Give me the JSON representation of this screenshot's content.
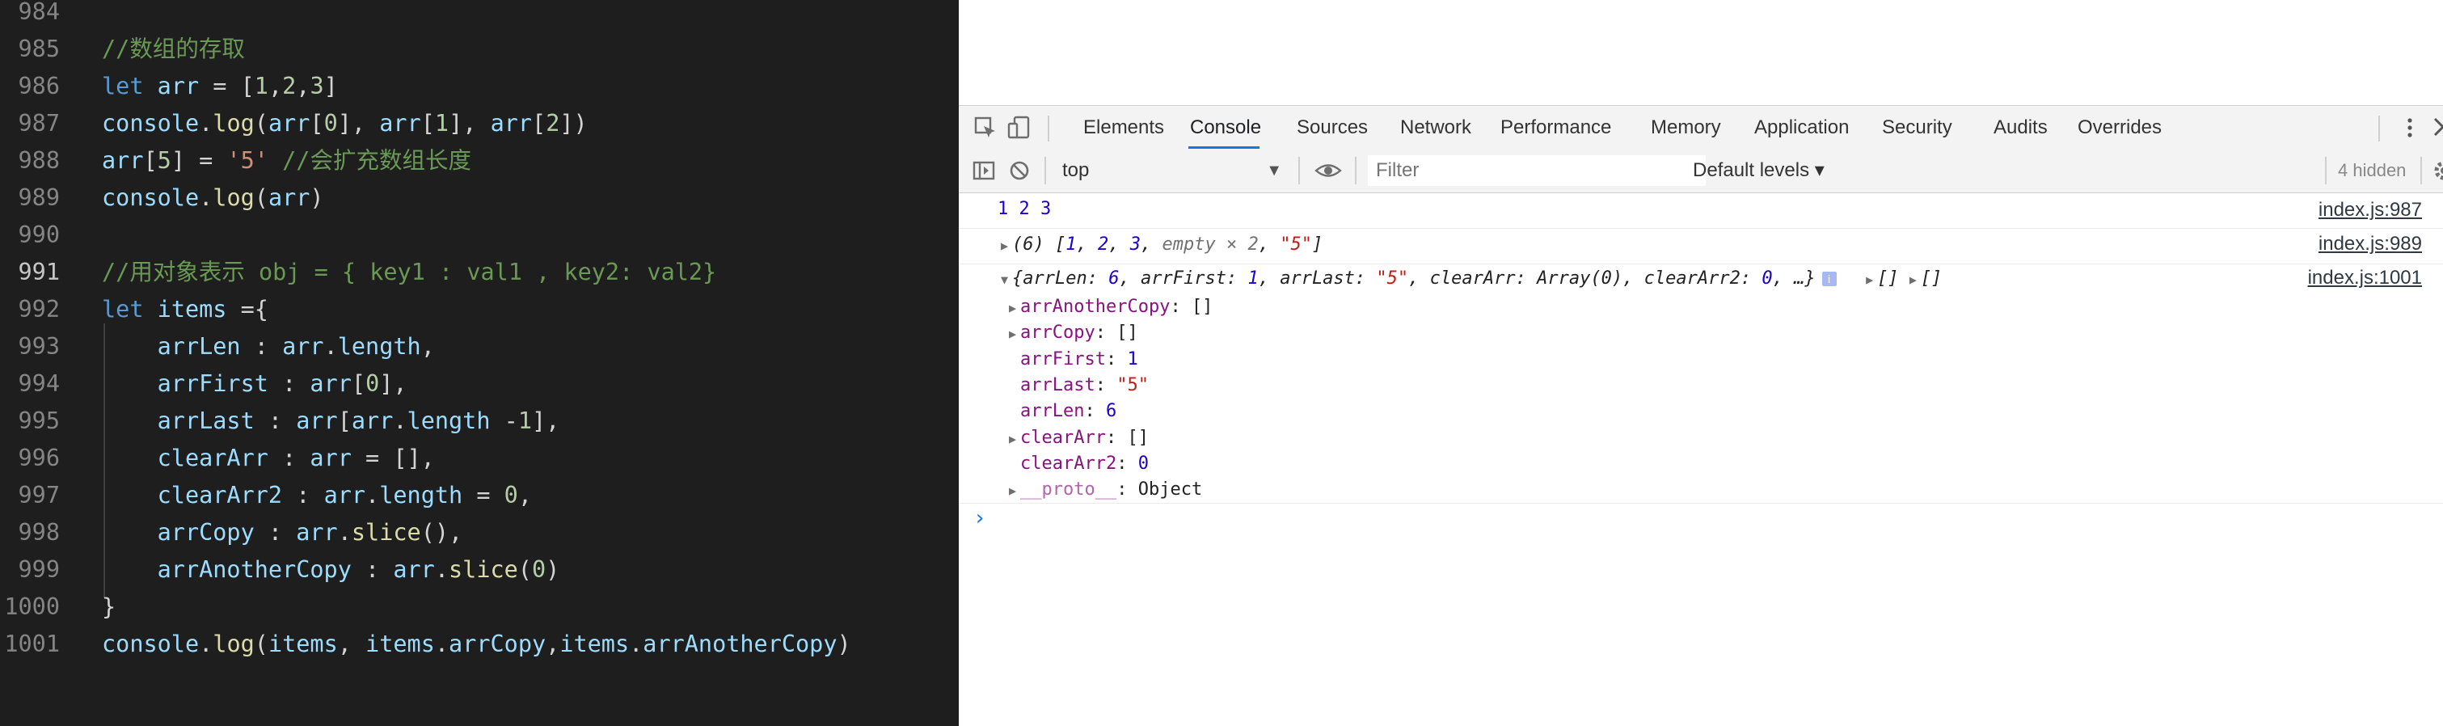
{
  "editor": {
    "lines": [
      {
        "n": "984",
        "tokens": []
      },
      {
        "n": "985",
        "tokens": [
          {
            "t": "//数组的存取",
            "c": "comment"
          }
        ]
      },
      {
        "n": "986",
        "tokens": [
          {
            "t": "let",
            "c": "keyword"
          },
          {
            "t": " ",
            "c": "plain"
          },
          {
            "t": "arr",
            "c": "var"
          },
          {
            "t": " = [",
            "c": "plain"
          },
          {
            "t": "1",
            "c": "num"
          },
          {
            "t": ",",
            "c": "plain"
          },
          {
            "t": "2",
            "c": "num"
          },
          {
            "t": ",",
            "c": "plain"
          },
          {
            "t": "3",
            "c": "num"
          },
          {
            "t": "]",
            "c": "plain"
          }
        ]
      },
      {
        "n": "987",
        "tokens": [
          {
            "t": "console",
            "c": "var"
          },
          {
            "t": ".",
            "c": "plain"
          },
          {
            "t": "log",
            "c": "func"
          },
          {
            "t": "(",
            "c": "plain"
          },
          {
            "t": "arr",
            "c": "var"
          },
          {
            "t": "[",
            "c": "plain"
          },
          {
            "t": "0",
            "c": "num"
          },
          {
            "t": "], ",
            "c": "plain"
          },
          {
            "t": "arr",
            "c": "var"
          },
          {
            "t": "[",
            "c": "plain"
          },
          {
            "t": "1",
            "c": "num"
          },
          {
            "t": "], ",
            "c": "plain"
          },
          {
            "t": "arr",
            "c": "var"
          },
          {
            "t": "[",
            "c": "plain"
          },
          {
            "t": "2",
            "c": "num"
          },
          {
            "t": "])",
            "c": "plain"
          }
        ]
      },
      {
        "n": "988",
        "tokens": [
          {
            "t": "arr",
            "c": "var"
          },
          {
            "t": "[",
            "c": "plain"
          },
          {
            "t": "5",
            "c": "num"
          },
          {
            "t": "] = ",
            "c": "plain"
          },
          {
            "t": "'5'",
            "c": "str"
          },
          {
            "t": " ",
            "c": "plain"
          },
          {
            "t": "//会扩充数组长度",
            "c": "comment"
          }
        ]
      },
      {
        "n": "989",
        "tokens": [
          {
            "t": "console",
            "c": "var"
          },
          {
            "t": ".",
            "c": "plain"
          },
          {
            "t": "log",
            "c": "func"
          },
          {
            "t": "(",
            "c": "plain"
          },
          {
            "t": "arr",
            "c": "var"
          },
          {
            "t": ")",
            "c": "plain"
          }
        ]
      },
      {
        "n": "990",
        "tokens": []
      },
      {
        "n": "991",
        "active": true,
        "tokens": [
          {
            "t": "//用对象表示 obj = { key1 : val1 , key2: val2}",
            "c": "comment"
          }
        ]
      },
      {
        "n": "992",
        "tokens": [
          {
            "t": "let",
            "c": "keyword"
          },
          {
            "t": " ",
            "c": "plain"
          },
          {
            "t": "items",
            "c": "var"
          },
          {
            "t": " ={",
            "c": "plain"
          }
        ]
      },
      {
        "n": "993",
        "tokens": [
          {
            "t": "    ",
            "c": "plain"
          },
          {
            "t": "arrLen",
            "c": "var"
          },
          {
            "t": " : ",
            "c": "plain"
          },
          {
            "t": "arr",
            "c": "var"
          },
          {
            "t": ".",
            "c": "plain"
          },
          {
            "t": "length",
            "c": "var"
          },
          {
            "t": ",",
            "c": "plain"
          }
        ]
      },
      {
        "n": "994",
        "tokens": [
          {
            "t": "    ",
            "c": "plain"
          },
          {
            "t": "arrFirst",
            "c": "var"
          },
          {
            "t": " : ",
            "c": "plain"
          },
          {
            "t": "arr",
            "c": "var"
          },
          {
            "t": "[",
            "c": "plain"
          },
          {
            "t": "0",
            "c": "num"
          },
          {
            "t": "],",
            "c": "plain"
          }
        ]
      },
      {
        "n": "995",
        "tokens": [
          {
            "t": "    ",
            "c": "plain"
          },
          {
            "t": "arrLast",
            "c": "var"
          },
          {
            "t": " : ",
            "c": "plain"
          },
          {
            "t": "arr",
            "c": "var"
          },
          {
            "t": "[",
            "c": "plain"
          },
          {
            "t": "arr",
            "c": "var"
          },
          {
            "t": ".",
            "c": "plain"
          },
          {
            "t": "length",
            "c": "var"
          },
          {
            "t": " -",
            "c": "plain"
          },
          {
            "t": "1",
            "c": "num"
          },
          {
            "t": "],",
            "c": "plain"
          }
        ]
      },
      {
        "n": "996",
        "tokens": [
          {
            "t": "    ",
            "c": "plain"
          },
          {
            "t": "clearArr",
            "c": "var"
          },
          {
            "t": " : ",
            "c": "plain"
          },
          {
            "t": "arr",
            "c": "var"
          },
          {
            "t": " = [],",
            "c": "plain"
          }
        ]
      },
      {
        "n": "997",
        "tokens": [
          {
            "t": "    ",
            "c": "plain"
          },
          {
            "t": "clearArr2",
            "c": "var"
          },
          {
            "t": " : ",
            "c": "plain"
          },
          {
            "t": "arr",
            "c": "var"
          },
          {
            "t": ".",
            "c": "plain"
          },
          {
            "t": "length",
            "c": "var"
          },
          {
            "t": " = ",
            "c": "plain"
          },
          {
            "t": "0",
            "c": "num"
          },
          {
            "t": ",",
            "c": "plain"
          }
        ]
      },
      {
        "n": "998",
        "tokens": [
          {
            "t": "    ",
            "c": "plain"
          },
          {
            "t": "arrCopy",
            "c": "var"
          },
          {
            "t": " : ",
            "c": "plain"
          },
          {
            "t": "arr",
            "c": "var"
          },
          {
            "t": ".",
            "c": "plain"
          },
          {
            "t": "slice",
            "c": "func"
          },
          {
            "t": "(),",
            "c": "plain"
          }
        ]
      },
      {
        "n": "999",
        "tokens": [
          {
            "t": "    ",
            "c": "plain"
          },
          {
            "t": "arrAnotherCopy",
            "c": "var"
          },
          {
            "t": " : ",
            "c": "plain"
          },
          {
            "t": "arr",
            "c": "var"
          },
          {
            "t": ".",
            "c": "plain"
          },
          {
            "t": "slice",
            "c": "func"
          },
          {
            "t": "(",
            "c": "plain"
          },
          {
            "t": "0",
            "c": "num"
          },
          {
            "t": ")",
            "c": "plain"
          }
        ]
      },
      {
        "n": "1000",
        "tokens": [
          {
            "t": "}",
            "c": "plain"
          }
        ]
      },
      {
        "n": "1001",
        "tokens": [
          {
            "t": "console",
            "c": "var"
          },
          {
            "t": ".",
            "c": "plain"
          },
          {
            "t": "log",
            "c": "func"
          },
          {
            "t": "(",
            "c": "plain"
          },
          {
            "t": "items",
            "c": "var"
          },
          {
            "t": ", ",
            "c": "plain"
          },
          {
            "t": "items",
            "c": "var"
          },
          {
            "t": ".",
            "c": "plain"
          },
          {
            "t": "arrCopy",
            "c": "var"
          },
          {
            "t": ",",
            "c": "plain"
          },
          {
            "t": "items",
            "c": "var"
          },
          {
            "t": ".",
            "c": "plain"
          },
          {
            "t": "arrAnotherCopy",
            "c": "var"
          },
          {
            "t": ")",
            "c": "plain"
          }
        ]
      }
    ]
  },
  "devtools": {
    "tabs": [
      {
        "label": "Elements"
      },
      {
        "label": "Console",
        "selected": true
      },
      {
        "label": "Sources"
      },
      {
        "label": "Network"
      },
      {
        "label": "Performance"
      },
      {
        "label": "Memory"
      },
      {
        "label": "Application"
      },
      {
        "label": "Security"
      },
      {
        "label": "Audits"
      },
      {
        "label": "Overrides"
      }
    ],
    "icons": {
      "inspect": "inspect-element-icon",
      "device": "device-toolbar-icon",
      "more": "kebab-menu-icon",
      "close": "close-icon",
      "sidebar": "console-sidebar-icon",
      "clear": "clear-console-icon",
      "eye": "live-expression-eye-icon",
      "settings": "gear-icon"
    },
    "toolbar": {
      "context": "top",
      "context_caret": "▼",
      "filter_placeholder": "Filter",
      "levels": "Default levels ▾",
      "hidden": "4 hidden"
    },
    "messages": {
      "m1": {
        "text": "1 2 3",
        "source": "index.js:987"
      },
      "m2": {
        "arrow": "▶",
        "prefix": "(6) [",
        "v1": "1",
        "sep1": ", ",
        "v2": "2",
        "sep2": ", ",
        "v3": "3",
        "sep3": ", ",
        "empty": "empty × 2",
        "sep4": ", ",
        "v5": "\"5\"",
        "suffix": "]",
        "source": "index.js:989"
      },
      "m3": {
        "arrow": "▼",
        "summary_open": "{",
        "k1": "arrLen",
        "v1": "6",
        "k2": "arrFirst",
        "v2": "1",
        "k3": "arrLast",
        "v3": "\"5\"",
        "k4": "clearArr",
        "v4": "Array(0)",
        "k5": "clearArr2",
        "v5": "0",
        "summary_close": ", …}",
        "info": "i",
        "extra1_arrow": "▶",
        "extra1": "[]",
        "extra2_arrow": "▶",
        "extra2": "[]",
        "source": "index.js:1001",
        "props": [
          {
            "arrow": "▶",
            "key": "arrAnotherCopy",
            "value": "[]",
            "vtype": "plain"
          },
          {
            "arrow": "▶",
            "key": "arrCopy",
            "value": "[]",
            "vtype": "plain"
          },
          {
            "arrow": "",
            "key": "arrFirst",
            "value": "1",
            "vtype": "num"
          },
          {
            "arrow": "",
            "key": "arrLast",
            "value": "\"5\"",
            "vtype": "str"
          },
          {
            "arrow": "",
            "key": "arrLen",
            "value": "6",
            "vtype": "num"
          },
          {
            "arrow": "▶",
            "key": "clearArr",
            "value": "[]",
            "vtype": "plain"
          },
          {
            "arrow": "",
            "key": "clearArr2",
            "value": "0",
            "vtype": "num"
          },
          {
            "arrow": "▶",
            "key": "__proto__",
            "value": "Object",
            "vtype": "plain",
            "dim": true
          }
        ]
      }
    },
    "prompt": "›"
  }
}
